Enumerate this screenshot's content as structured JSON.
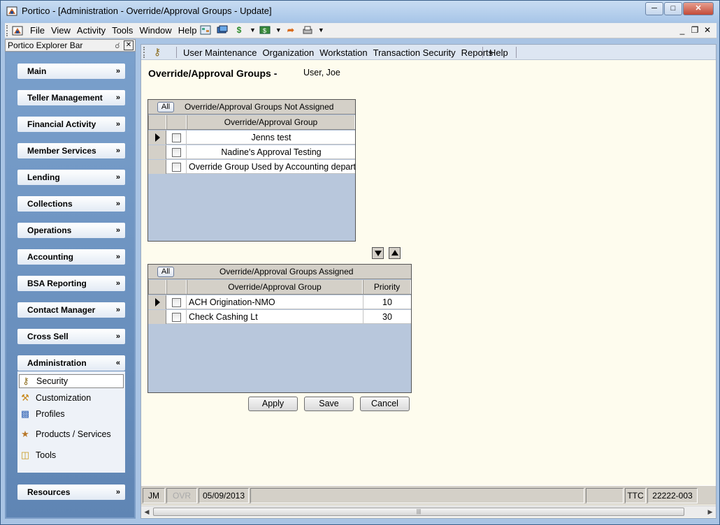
{
  "window": {
    "title": "Portico - [Administration - Override/Approval Groups - Update]",
    "controls": [
      "minimize",
      "maximize",
      "close"
    ]
  },
  "menubar": {
    "items": [
      "File",
      "View",
      "Activity",
      "Tools",
      "Window",
      "Help"
    ],
    "toolbar_icons": [
      "calendar-icon",
      "cards-icon",
      "dollar-icon",
      "cash-icon",
      "forward-arrow-icon",
      "printer-icon"
    ],
    "mdi_controls": [
      "_",
      "❐",
      "✕"
    ]
  },
  "explorer": {
    "title": "Portico Explorer Bar",
    "groups": [
      {
        "label": "Main",
        "expanded": false
      },
      {
        "label": "Teller Management",
        "expanded": false
      },
      {
        "label": "Financial Activity",
        "expanded": false
      },
      {
        "label": "Member Services",
        "expanded": false
      },
      {
        "label": "Lending",
        "expanded": false
      },
      {
        "label": "Collections",
        "expanded": false
      },
      {
        "label": "Operations",
        "expanded": false
      },
      {
        "label": "Accounting",
        "expanded": false
      },
      {
        "label": "BSA Reporting",
        "expanded": false
      },
      {
        "label": "Contact Manager",
        "expanded": false
      },
      {
        "label": "Cross Sell",
        "expanded": false
      },
      {
        "label": "Administration",
        "expanded": true
      },
      {
        "label": "Resources",
        "expanded": false
      }
    ],
    "admin_items": [
      {
        "label": "Security",
        "icon": "security-key-icon",
        "selected": true
      },
      {
        "label": "Customization",
        "icon": "customization-icon",
        "selected": false
      },
      {
        "label": "Profiles",
        "icon": "profiles-icon",
        "selected": false
      },
      {
        "label": "Products / Services",
        "icon": "products-icon",
        "selected": false
      },
      {
        "label": "Tools",
        "icon": "tools-icon",
        "selected": false
      }
    ]
  },
  "content_menu": {
    "items": [
      "User Maintenance",
      "Organization",
      "Workstation",
      "Transaction Security",
      "Reports"
    ],
    "help": "Help"
  },
  "page": {
    "title": "Override/Approval Groups",
    "dash": "-",
    "user": "User, Joe"
  },
  "not_assigned": {
    "all_label": "All",
    "caption": "Override/Approval Groups Not Assigned",
    "column": "Override/Approval Group",
    "rows": [
      {
        "name": "Jenns test",
        "current": true
      },
      {
        "name": "Nadine's Approval Testing",
        "current": false
      },
      {
        "name": "Override Group Used by Accounting departm",
        "current": false
      }
    ]
  },
  "assigned": {
    "all_label": "All",
    "caption": "Override/Approval Groups Assigned",
    "columns": [
      "Override/Approval Group",
      "Priority"
    ],
    "rows": [
      {
        "name": "ACH Origination-NMO",
        "priority": "10",
        "current": true
      },
      {
        "name": "Check Cashing Lt",
        "priority": "30",
        "current": false
      }
    ]
  },
  "buttons": {
    "apply": "Apply",
    "save": "Save",
    "cancel": "Cancel"
  },
  "statusbar": {
    "user": "JM",
    "ovr": "OVR",
    "date": "05/09/2013",
    "ttc": "TTC",
    "branch": "22222-003"
  }
}
